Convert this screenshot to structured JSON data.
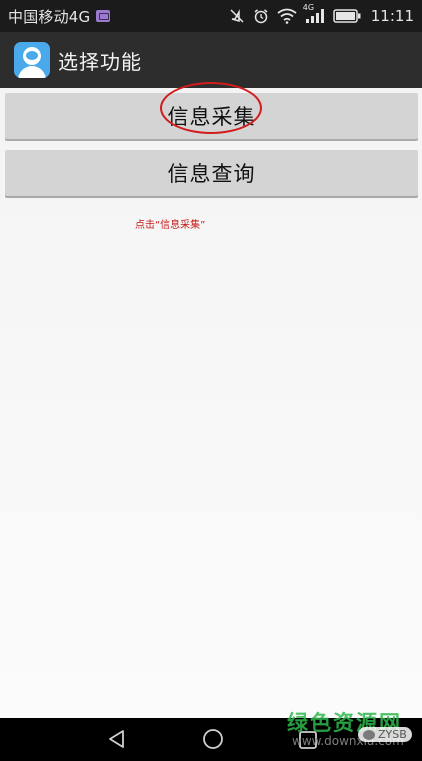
{
  "status_bar": {
    "carrier": "中国移动4G",
    "network_label": "4G",
    "time": "11:11",
    "icons": [
      "message-icon",
      "mute-icon",
      "alarm-icon",
      "wifi-icon",
      "signal-icon",
      "battery-icon"
    ]
  },
  "action_bar": {
    "title": "选择功能",
    "app_icon": "user-avatar-icon",
    "app_icon_color": "#49a9ea"
  },
  "buttons": {
    "collect_label": "信息采集",
    "query_label": "信息查询"
  },
  "hint": "点击“信息采集”",
  "colors": {
    "highlight": "#d21c1c",
    "button_bg": "#d4d4d4",
    "actionbar_bg": "#2d2d2d"
  },
  "nav_bar": {
    "icons": [
      "back-icon",
      "home-icon",
      "recent-apps-icon"
    ]
  },
  "watermark": {
    "text": "绿色资源网",
    "url": "www.downxia.com",
    "badge": "ZYSB"
  }
}
